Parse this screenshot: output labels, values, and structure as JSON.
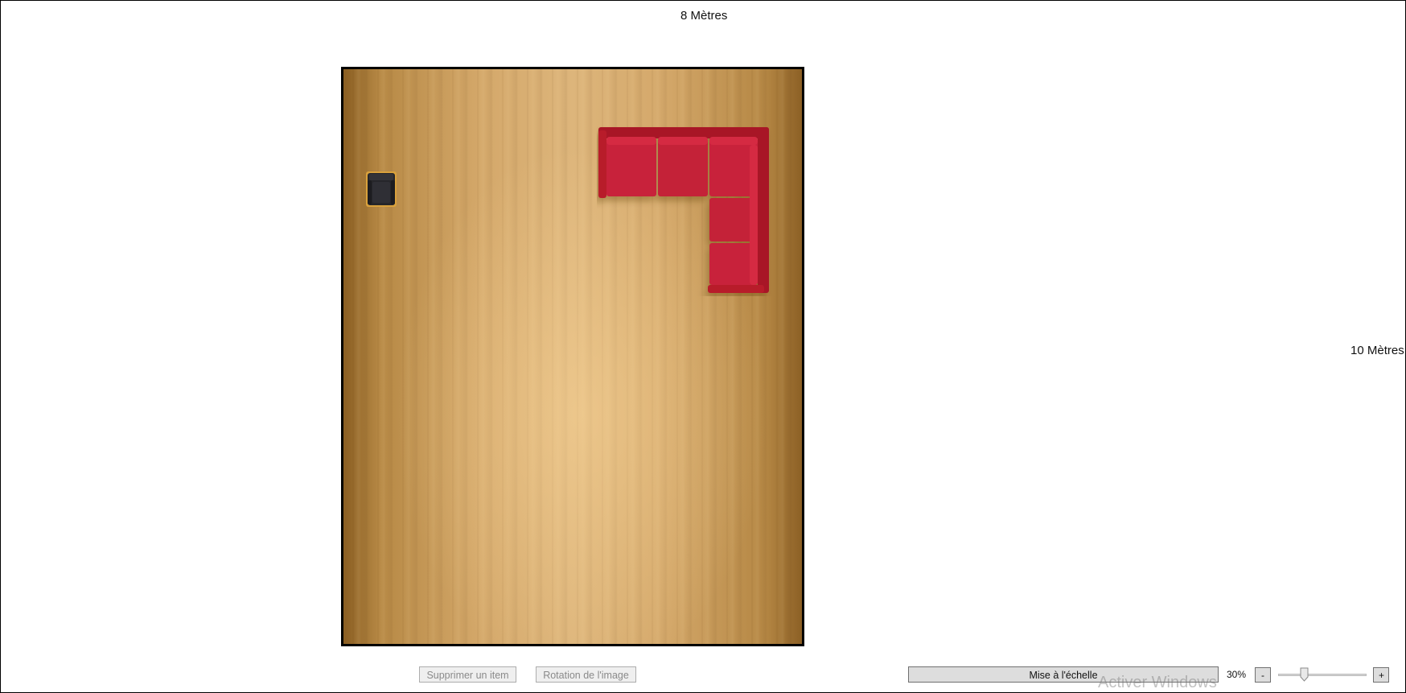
{
  "dimensions": {
    "width_label": "8 Mètres",
    "height_label": "10 Mètres"
  },
  "room": {
    "floor_texture": "wood-floor",
    "furniture": [
      {
        "name": "armchair",
        "color": "#2a2a2e"
      },
      {
        "name": "l-shaped-sofa",
        "color": "#c41f33"
      }
    ]
  },
  "toolbar": {
    "delete_label": "Supprimer un item",
    "rotate_label": "Rotation de l'image",
    "scale_label": "Mise à l'échelle",
    "zoom_value": "30%",
    "zoom_minus": "-",
    "zoom_plus": "+",
    "zoom_slider_fraction": 0.27
  },
  "os_watermark": "Activer Windows"
}
